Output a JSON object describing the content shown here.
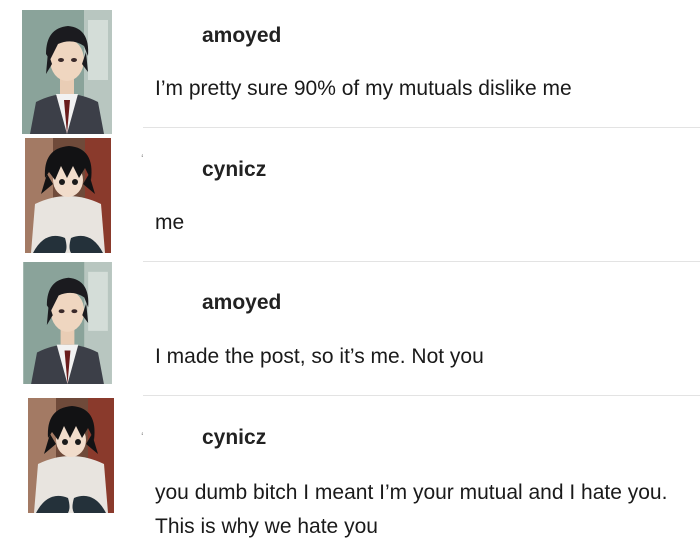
{
  "thread": {
    "posts": [
      {
        "username": "amoyed",
        "avatar": "suited-man-avatar",
        "text": "I’m pretty sure 90% of my mutuals dislike me"
      },
      {
        "username": "cynicz",
        "avatar": "crouching-man-avatar",
        "text": "me"
      },
      {
        "username": "amoyed",
        "avatar": "suited-man-avatar",
        "text": "I made the post, so it’s me. Not you"
      },
      {
        "username": "cynicz",
        "avatar": "crouching-man-avatar",
        "text": "you dumb bitch I meant I’m your mutual and I hate you. This is why we hate you"
      }
    ]
  },
  "colors": {
    "text": "#1a1a1a",
    "divider": "#e3e3e3",
    "background": "#ffffff"
  }
}
